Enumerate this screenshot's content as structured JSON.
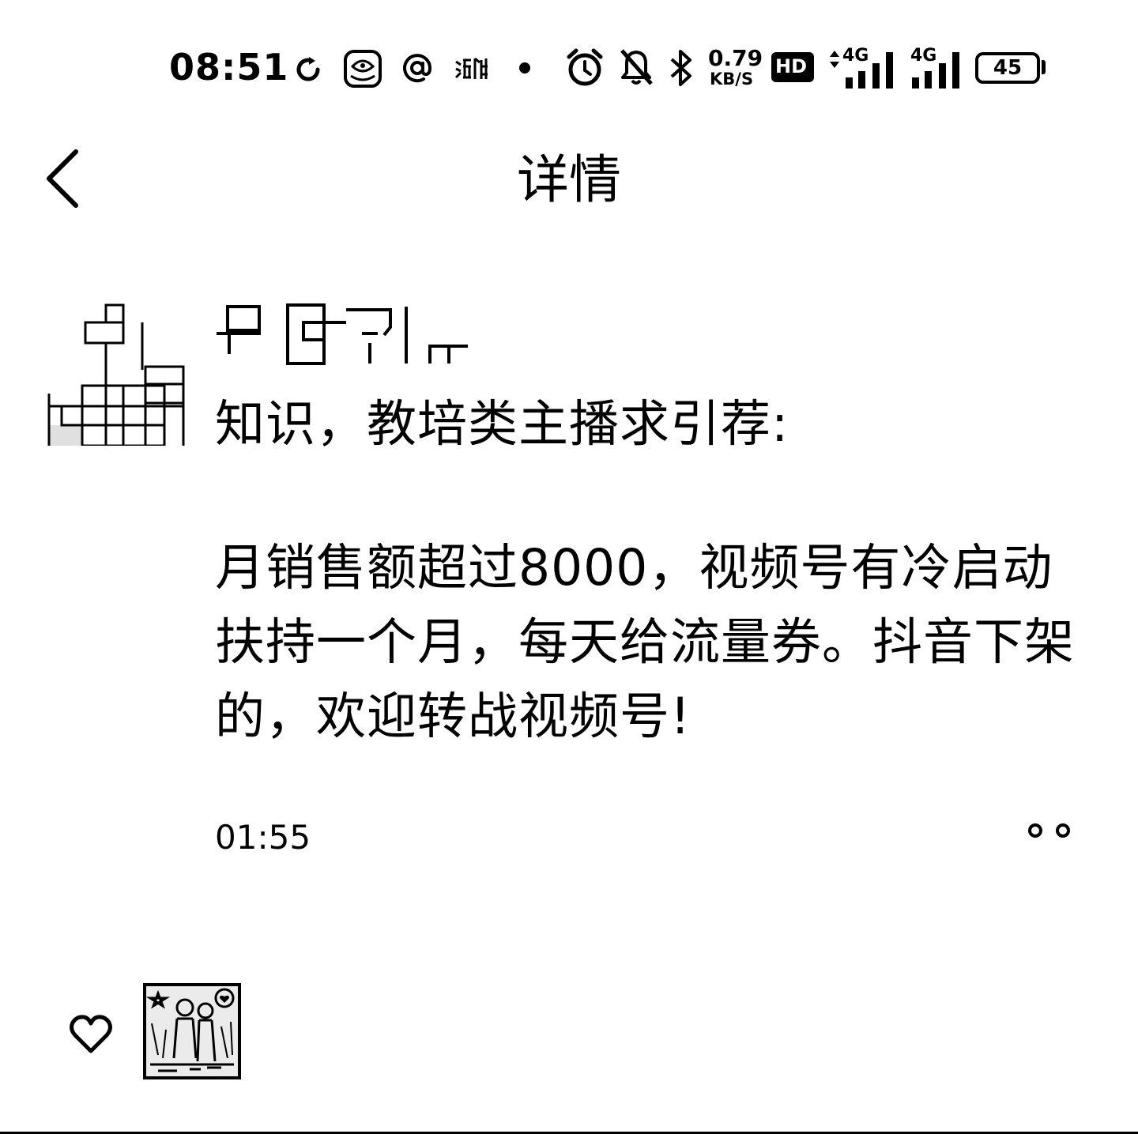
{
  "status_bar": {
    "time": "08:51",
    "network_speed_value": "0.79",
    "network_speed_unit": "KB/S",
    "hd_label": "HD",
    "sim1_network": "4G",
    "sim2_network": "4G",
    "battery": "45",
    "notification_icons": [
      "sync-icon",
      "app-icon",
      "at-icon",
      "pengpai-icon",
      "dot-icon"
    ],
    "system_icons": [
      "alarm-icon",
      "mute-icon",
      "bluetooth-icon",
      "hd-icon",
      "signal-icon",
      "signal-icon",
      "battery-icon"
    ]
  },
  "header": {
    "title": "详情",
    "back_icon": "chevron-left-icon"
  },
  "post": {
    "content": [
      "知识，教培类主播求引荐:",
      "月销售额超过8000，视频号有冷启动扶持一个月，每天给流量券。抖音下架的，欢迎转战视频号!"
    ],
    "time": "01:55",
    "more_icon": "more-dots-icon"
  },
  "likes": {
    "icon": "heart-outline-icon"
  }
}
